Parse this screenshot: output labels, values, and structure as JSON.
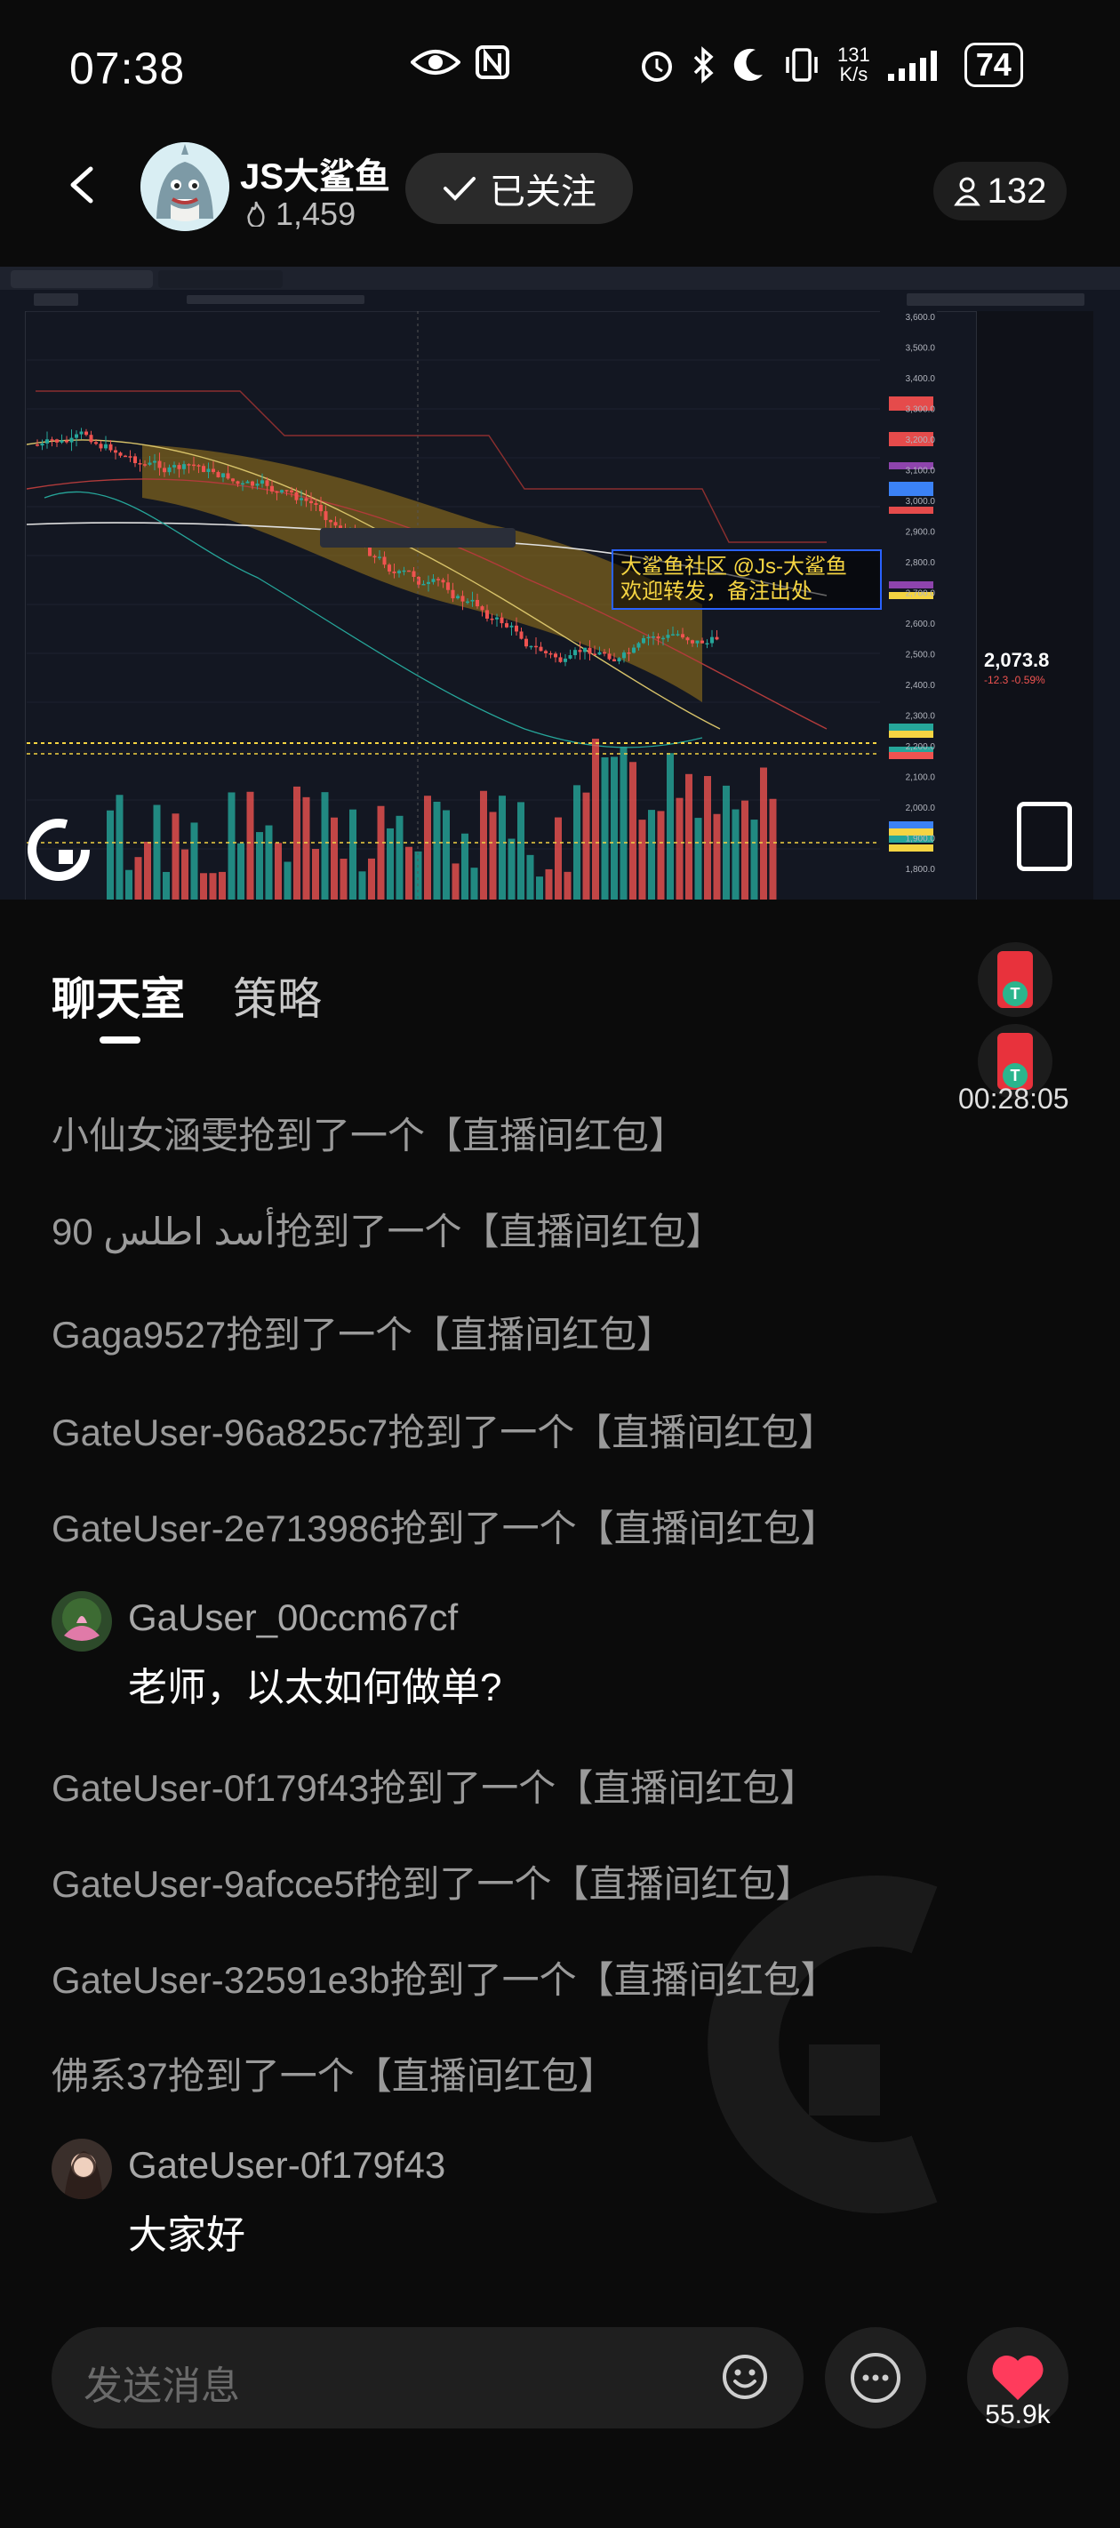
{
  "status_bar": {
    "time": "07:38",
    "net_speed_value": "131",
    "net_speed_unit": "K/s",
    "battery": "74"
  },
  "header": {
    "host_name": "JS大鲨鱼",
    "host_fans": "1,459",
    "follow_label": "已关注",
    "viewer_count": "132"
  },
  "chart": {
    "watermark_line1": "大鲨鱼社区 @Js-大鲨鱼",
    "watermark_line2": "欢迎转发，备注出处",
    "price_right_ticks": [
      "3,600.0",
      "3,500.0",
      "3,400.0",
      "3,300.0",
      "3,200.0",
      "3,100.0",
      "3,000.0",
      "2,900.0",
      "2,800.0",
      "2,700.0",
      "2,600.0",
      "2,500.0",
      "2,400.0",
      "2,300.0",
      "2,200.0",
      "2,100.0",
      "2,000.0",
      "1,900.0",
      "1,800.0"
    ],
    "ticker_price": "2,073.8",
    "ticker_change": "-12.3 -0.59%"
  },
  "tabs": {
    "chat": "聊天室",
    "strategy": "策略"
  },
  "red_packet": {
    "timer": "00:28:05"
  },
  "messages": [
    {
      "type": "system",
      "text": "小仙女涵雯抢到了一个【直播间红包】"
    },
    {
      "type": "system",
      "text": "90 أسد اطلس抢到了一个【直播间红包】"
    },
    {
      "type": "system",
      "text": "Gaga9527抢到了一个【直播间红包】"
    },
    {
      "type": "system",
      "text": "GateUser-96a825c7抢到了一个【直播间红包】"
    },
    {
      "type": "system",
      "text": "GateUser-2e713986抢到了一个【直播间红包】"
    },
    {
      "type": "user",
      "name": "GaUser_00ccm67cf",
      "text": "老师，以太如何做单?"
    },
    {
      "type": "system",
      "text": "GateUser-0f179f43抢到了一个【直播间红包】"
    },
    {
      "type": "system",
      "text": "GateUser-9afcce5f抢到了一个【直播间红包】"
    },
    {
      "type": "system",
      "text": "GateUser-32591e3b抢到了一个【直播间红包】"
    },
    {
      "type": "system",
      "text": "佛系37抢到了一个【直播间红包】"
    },
    {
      "type": "user",
      "name": "GateUser-0f179f43",
      "text": "大家好"
    }
  ],
  "bottom_bar": {
    "input_placeholder": "发送消息",
    "like_count": "55.9k"
  },
  "colors": {
    "background": "#0b0b0b",
    "like": "#ff3b5c",
    "red_packet": "#e8323c",
    "chart_bg": "#131722",
    "candle_up": "#26a69a",
    "candle_down": "#ef5350"
  }
}
